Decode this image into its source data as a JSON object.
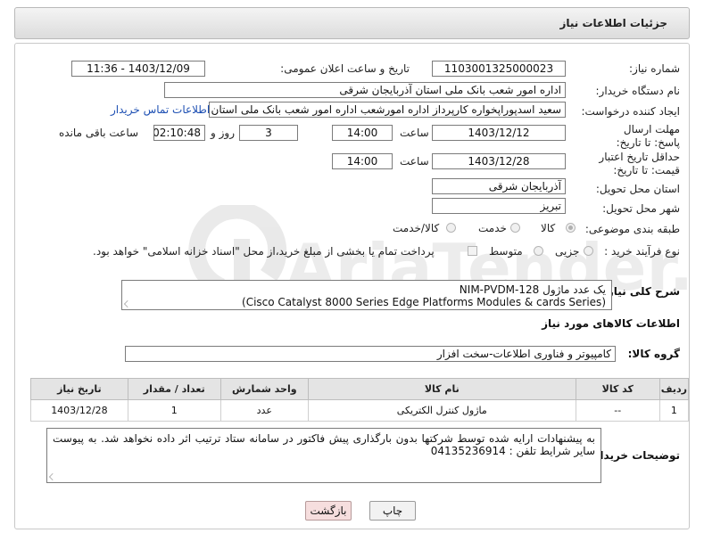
{
  "header": {
    "title": "جزئیات اطلاعات نیاز"
  },
  "fields": {
    "need_number_label": "شماره نیاز:",
    "need_number": "1103001325000023",
    "announce_label": "تاریخ و ساعت اعلان عمومی:",
    "announce_value": "1403/12/09 - 11:36",
    "buyer_org_label": "نام دستگاه خریدار:",
    "buyer_org": "اداره امور شعب بانک ملی استان آذربایجان شرقی",
    "creator_label": "ایجاد کننده درخواست:",
    "creator": "سعید اسدپوراپخواره کارپرداز اداره امورشعب  اداره امور شعب بانک ملی استان آذ",
    "contact_link": "اطلاعات تماس خریدار",
    "deadline_label": "مهلت ارسال پاسخ: تا تاریخ:",
    "deadline_date": "1403/12/12",
    "time_word": "ساعت",
    "deadline_time": "14:00",
    "days_value": "3",
    "days_word": "روز و",
    "remaining_time": "02:10:48",
    "remaining_word": "ساعت باقی مانده",
    "validity_label": "حداقل تاریخ اعتبار قیمت: تا تاریخ:",
    "validity_date": "1403/12/28",
    "validity_time": "14:00",
    "province_label": "استان محل تحویل:",
    "province": "آذربایجان شرقی",
    "city_label": "شهر محل تحویل:",
    "city": "تبریز",
    "category_label": "طبقه بندی موضوعی:",
    "category_options": [
      "کالا",
      "خدمت",
      "کالا/خدمت"
    ],
    "purchase_label": "نوع فرآیند خرید :",
    "purchase_options": [
      "جزیی",
      "متوسط"
    ],
    "payment_note": "پرداخت تمام یا بخشی از مبلغ خرید،از محل \"اسناد خزانه اسلامی\" خواهد بود."
  },
  "summary": {
    "label": "شرح کلی نیاز:",
    "line1": "یک عدد ماژول  NIM-PVDM-128",
    "line2": "(Cisco Catalyst 8000 Series Edge Platforms Modules & cards Series)"
  },
  "goods_info": {
    "heading": "اطلاعات کالاهای مورد نیاز",
    "group_label": "گروه کالا:",
    "group_value": "کامپیوتر و فناوری اطلاعات-سخت افزار"
  },
  "table": {
    "headers": [
      "ردیف",
      "کد کالا",
      "نام کالا",
      "واحد شمارش",
      "تعداد / مقدار",
      "تاریخ نیاز"
    ],
    "rows": [
      [
        "1",
        "--",
        "ماژول کنترل الکتریکی",
        "عدد",
        "1",
        "1403/12/28"
      ]
    ]
  },
  "buyer_notes": {
    "label": "توضیحات خریدار:",
    "text": "به پیشنهادات ارایه شده توسط شرکتها بدون بارگذاری پیش فاکتور در سامانه ستاد ترتیب اثر داده نخواهد شد. به پیوست سایر شرایط           تلفن : 04135236914"
  },
  "buttons": {
    "print": "چاپ",
    "back": "بازگشت"
  },
  "watermark": {
    "text": "AriaTender.net"
  }
}
